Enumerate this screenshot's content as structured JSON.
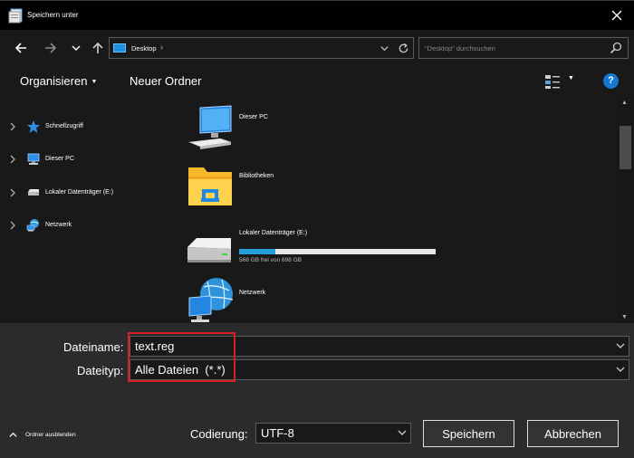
{
  "window": {
    "title": "Speichern unter",
    "icon": "save-dialog-icon"
  },
  "address": {
    "location": "Desktop",
    "separator": "›",
    "search_placeholder": "\"Desktop\" durchsuchen"
  },
  "toolbar": {
    "organize_label": "Organisieren",
    "new_folder_label": "Neuer Ordner",
    "help_label": "?"
  },
  "navpane": {
    "items": [
      {
        "label": "Schnellzugriff",
        "icon": "star-icon"
      },
      {
        "label": "Dieser PC",
        "icon": "computer-icon"
      },
      {
        "label": "Lokaler Datenträger (E:)",
        "icon": "drive-icon"
      },
      {
        "label": "Netzwerk",
        "icon": "network-icon"
      }
    ]
  },
  "content": {
    "items": [
      {
        "label": "Dieser PC",
        "icon": "computer-icon"
      },
      {
        "label": "Bibliotheken",
        "icon": "libraries-folder-icon"
      },
      {
        "label": "Lokaler Datenträger (E:)",
        "icon": "drive-icon",
        "free_text": "568 GB frei von 698 GB",
        "used_fraction": 0.186
      },
      {
        "label": "Netzwerk",
        "icon": "network-icon"
      }
    ]
  },
  "form": {
    "filename_label": "Dateiname:",
    "filename_value": "text.reg",
    "filetype_label": "Dateityp:",
    "filetype_value": "Alle Dateien  (*.*)",
    "encoding_label": "Codierung:",
    "encoding_value": "UTF-8",
    "hide_folders_label": "Ordner ausblenden",
    "save_label": "Speichern",
    "cancel_label": "Abbrechen"
  },
  "colors": {
    "accent": "#1577d0",
    "highlight_border": "#d91f26",
    "drive_fill": "#26a0da"
  }
}
